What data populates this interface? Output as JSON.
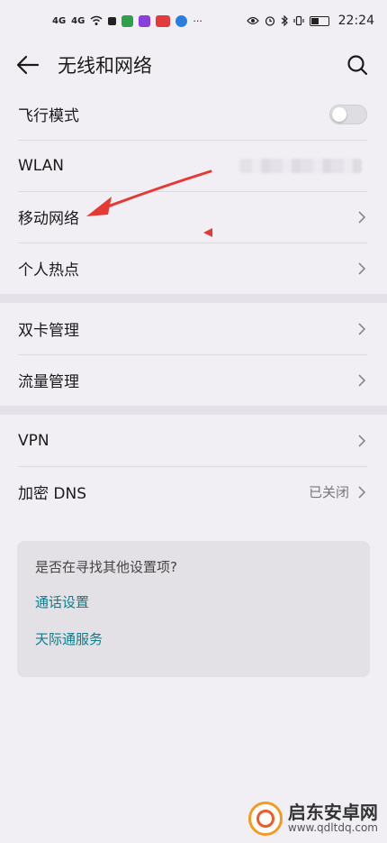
{
  "status_bar": {
    "signal_1": "4G",
    "signal_2": "4G",
    "dots": "···",
    "time": "22:24",
    "app_badge_1_color": "#2ea04a",
    "app_badge_2_color": "#8a3fe0",
    "app_badge_3_color": "#e23b3b",
    "app_badge_4_color": "#2a7de1"
  },
  "header": {
    "title": "无线和网络"
  },
  "group1": {
    "items": [
      {
        "label": "飞行模式",
        "toggle": false
      },
      {
        "label": "WLAN"
      },
      {
        "label": "移动网络"
      },
      {
        "label": "个人热点"
      }
    ]
  },
  "group2": {
    "items": [
      {
        "label": "双卡管理"
      },
      {
        "label": "流量管理"
      }
    ]
  },
  "group3": {
    "items": [
      {
        "label": "VPN"
      },
      {
        "label": "加密 DNS",
        "value": "已关闭"
      }
    ]
  },
  "hint": {
    "title": "是否在寻找其他设置项?",
    "links": [
      "通话设置",
      "天际通服务"
    ]
  },
  "watermark": {
    "name": "启东安卓网",
    "url": "www.qdltdq.com"
  },
  "colors": {
    "accent_link": "#0a7d8c",
    "annotation_arrow": "#e53935"
  }
}
